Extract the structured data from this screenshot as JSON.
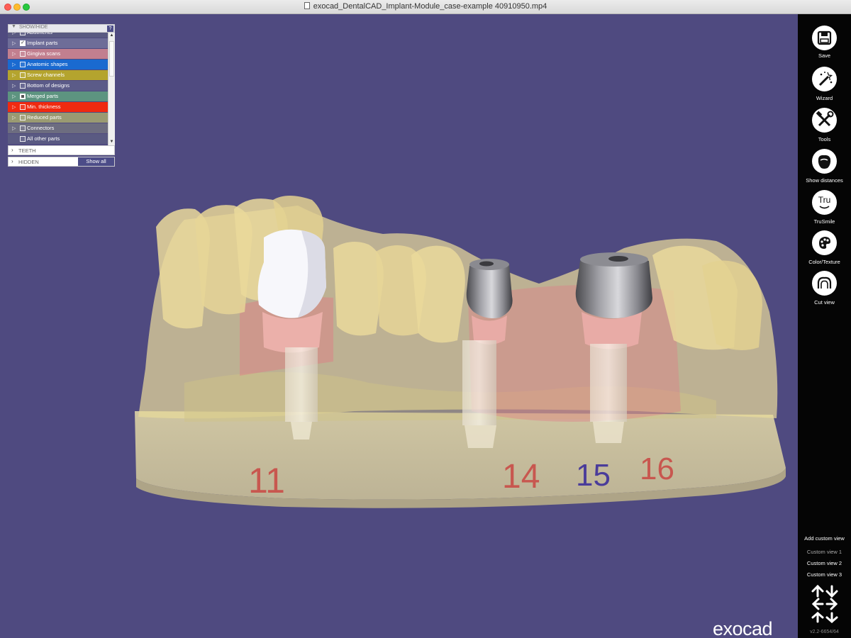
{
  "window": {
    "title": "exocad_DentalCAD_Implant-Module_case-example 40910950.mp4"
  },
  "show_hide_panel": {
    "header": "SHOW/HIDE",
    "help_label": "?",
    "items": [
      {
        "label": "Abutments",
        "color": "#5a5a82",
        "checked": false
      },
      {
        "label": "Implant parts",
        "color": "#6e6d98",
        "checked": true
      },
      {
        "label": "Gingiva scans",
        "color": "#c27f8f",
        "checked": false
      },
      {
        "label": "Anatomic shapes",
        "color": "#1a6ad0",
        "checked": false
      },
      {
        "label": "Screw channels",
        "color": "#b4a42e",
        "checked": false
      },
      {
        "label": "Bottom of designs",
        "color": "#5b5b88",
        "checked": false
      },
      {
        "label": "Merged parts",
        "color": "#5d9480",
        "checked": "partial"
      },
      {
        "label": "Min. thickness",
        "color": "#f02a10",
        "checked": false
      },
      {
        "label": "Reduced parts",
        "color": "#9a9a72",
        "checked": false
      },
      {
        "label": "Connectors",
        "color": "#6d6d80",
        "checked": false
      },
      {
        "label": "All other parts",
        "color": "#5a5a82",
        "checked": false
      }
    ],
    "teeth_section": "TEETH",
    "hidden_section": "HIDDEN",
    "show_all_label": "Show all"
  },
  "viewport": {
    "background": "#4f4a80",
    "tooth_numbers": [
      "11",
      "14",
      "15",
      "16"
    ],
    "brand": "exocad"
  },
  "toolbar": {
    "tools": [
      {
        "label": "Save",
        "icon": "save-icon"
      },
      {
        "label": "Wizard",
        "icon": "wizard-wand-icon"
      },
      {
        "label": "Tools",
        "icon": "tools-icon"
      },
      {
        "label": "Show distances",
        "icon": "show-distances-icon"
      },
      {
        "label": "TruSmile",
        "icon": "trusmile-icon",
        "icon_text": "Tru"
      },
      {
        "label": "Color/Texture",
        "icon": "color-palette-icon"
      },
      {
        "label": "Cut view",
        "icon": "cut-view-icon"
      }
    ],
    "custom_views": {
      "add": "Add custom view",
      "views": [
        "Custom view 1",
        "Custom view 2",
        "Custom view 3"
      ]
    },
    "version": "v2.2-6654/64"
  }
}
